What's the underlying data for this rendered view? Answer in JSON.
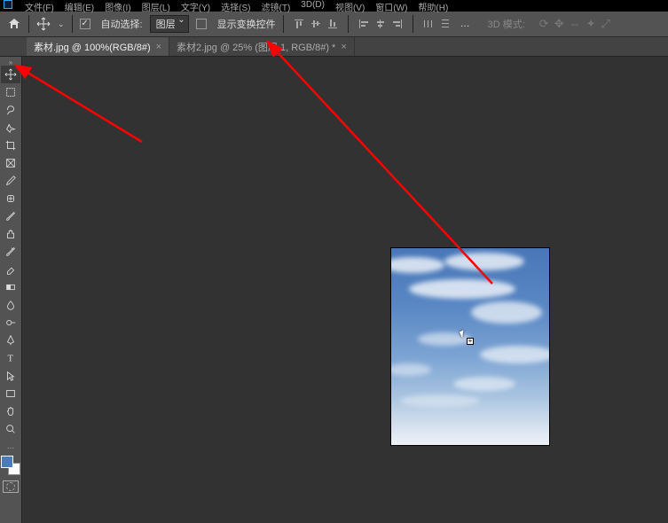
{
  "menubar": {
    "items": [
      "文件(F)",
      "编辑(E)",
      "图像(I)",
      "图层(L)",
      "文字(Y)",
      "选择(S)",
      "滤镜(T)",
      "3D(D)",
      "视图(V)",
      "窗口(W)",
      "帮助(H)"
    ]
  },
  "options": {
    "auto_select_label": "自动选择:",
    "dropdown_layer": "图层",
    "show_transform_label": "显示变换控件",
    "mode3d_label": "3D 模式:"
  },
  "tabs": [
    {
      "label": "素材.jpg @ 100%(RGB/8#)",
      "active": true
    },
    {
      "label": "素材2.jpg @ 25% (图层 1, RGB/8#) *",
      "active": false
    }
  ],
  "tools": [
    "move",
    "marquee",
    "lasso",
    "quick-select",
    "crop",
    "frame",
    "eyedropper",
    "healing",
    "brush",
    "clone",
    "history-brush",
    "eraser",
    "gradient",
    "blur",
    "dodge",
    "pen",
    "type",
    "path-select",
    "rectangle",
    "hand",
    "zoom"
  ],
  "swatch": {
    "fg": "#4a7cba",
    "bg": "#ffffff"
  }
}
